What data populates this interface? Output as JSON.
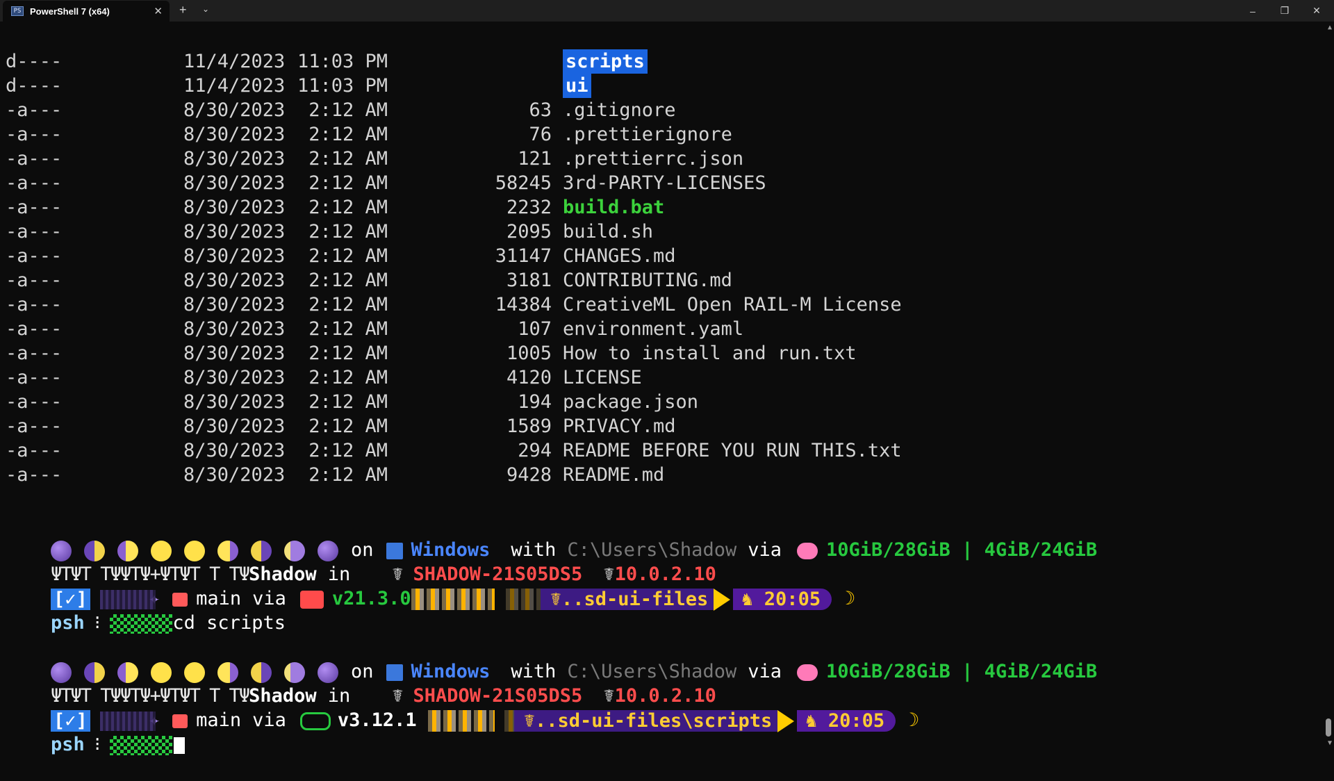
{
  "window": {
    "tab_title": "PowerShell 7 (x64)",
    "tab_icon": "PS",
    "new_tab": "+",
    "dropdown": "⌄",
    "minimize": "–",
    "maximize": "❐",
    "close": "✕",
    "tab_close": "✕"
  },
  "listing": [
    {
      "mode": "d----",
      "date": "11/4/2023",
      "time": "11:03 PM",
      "size": "",
      "name": "scripts",
      "kind": "dir"
    },
    {
      "mode": "d----",
      "date": "11/4/2023",
      "time": "11:03 PM",
      "size": "",
      "name": "ui",
      "kind": "dir"
    },
    {
      "mode": "-a---",
      "date": "8/30/2023",
      "time": "2:12 AM",
      "size": "63",
      "name": ".gitignore",
      "kind": "file"
    },
    {
      "mode": "-a---",
      "date": "8/30/2023",
      "time": "2:12 AM",
      "size": "76",
      "name": ".prettierignore",
      "kind": "file"
    },
    {
      "mode": "-a---",
      "date": "8/30/2023",
      "time": "2:12 AM",
      "size": "121",
      "name": ".prettierrc.json",
      "kind": "file"
    },
    {
      "mode": "-a---",
      "date": "8/30/2023",
      "time": "2:12 AM",
      "size": "58245",
      "name": "3rd-PARTY-LICENSES",
      "kind": "file"
    },
    {
      "mode": "-a---",
      "date": "8/30/2023",
      "time": "2:12 AM",
      "size": "2232",
      "name": "build.bat",
      "kind": "exe"
    },
    {
      "mode": "-a---",
      "date": "8/30/2023",
      "time": "2:12 AM",
      "size": "2095",
      "name": "build.sh",
      "kind": "file"
    },
    {
      "mode": "-a---",
      "date": "8/30/2023",
      "time": "2:12 AM",
      "size": "31147",
      "name": "CHANGES.md",
      "kind": "file"
    },
    {
      "mode": "-a---",
      "date": "8/30/2023",
      "time": "2:12 AM",
      "size": "3181",
      "name": "CONTRIBUTING.md",
      "kind": "file"
    },
    {
      "mode": "-a---",
      "date": "8/30/2023",
      "time": "2:12 AM",
      "size": "14384",
      "name": "CreativeML Open RAIL-M License",
      "kind": "file"
    },
    {
      "mode": "-a---",
      "date": "8/30/2023",
      "time": "2:12 AM",
      "size": "107",
      "name": "environment.yaml",
      "kind": "file"
    },
    {
      "mode": "-a---",
      "date": "8/30/2023",
      "time": "2:12 AM",
      "size": "1005",
      "name": "How to install and run.txt",
      "kind": "file"
    },
    {
      "mode": "-a---",
      "date": "8/30/2023",
      "time": "2:12 AM",
      "size": "4120",
      "name": "LICENSE",
      "kind": "file"
    },
    {
      "mode": "-a---",
      "date": "8/30/2023",
      "time": "2:12 AM",
      "size": "194",
      "name": "package.json",
      "kind": "file"
    },
    {
      "mode": "-a---",
      "date": "8/30/2023",
      "time": "2:12 AM",
      "size": "1589",
      "name": "PRIVACY.md",
      "kind": "file"
    },
    {
      "mode": "-a---",
      "date": "8/30/2023",
      "time": "2:12 AM",
      "size": "294",
      "name": "README BEFORE YOU RUN THIS.txt",
      "kind": "file"
    },
    {
      "mode": "-a---",
      "date": "8/30/2023",
      "time": "2:12 AM",
      "size": "9428",
      "name": "README.md",
      "kind": "file"
    }
  ],
  "prompts": [
    {
      "on": "on",
      "os": "Windows",
      "with": "with",
      "path": "C:\\Users\\Shadow",
      "via": "via",
      "memory": "10GiB/28GiB | 4GiB/24GiB",
      "glyphs": "ΨΤΨΤ ΤΨΨΤΨ+ΨΤΨΤ Τ ΤΨ",
      "user": "Shadow",
      "in": "in",
      "host": "SHADOW-21S05DS5",
      "ip": "10.0.2.10",
      "check": "[✓]",
      "branch": "main",
      "via2": "via",
      "runtime_version": "v21.3.0",
      "runtime_icon": "node-icon",
      "dir": "..sd-ui-files",
      "clock": "20:05",
      "moon": "☽",
      "shell": "psh",
      "command": "cd scripts"
    },
    {
      "on": "on",
      "os": "Windows",
      "with": "with",
      "path": "C:\\Users\\Shadow",
      "via": "via",
      "memory": "10GiB/28GiB | 4GiB/24GiB",
      "glyphs": "ΨΤΨΤ ΤΨΨΤΨ+ΨΤΨΤ Τ ΤΨ",
      "user": "Shadow",
      "in": "in",
      "host": "SHADOW-21S05DS5",
      "ip": "10.0.2.10",
      "check": "[✓]",
      "branch": "main",
      "via2": "via",
      "runtime_version": "v3.12.1",
      "runtime_icon": "python-icon",
      "dir": "..sd-ui-files\\scripts",
      "clock": "20:05",
      "moon": "☽",
      "shell": "psh",
      "command": ""
    }
  ],
  "colors": {
    "background": "#0c0c0c",
    "dir_highlight": "#1a64e0",
    "exe_green": "#3cd23c",
    "host_red": "#ff4d4d",
    "prompt_purple": "#3d1b83"
  }
}
